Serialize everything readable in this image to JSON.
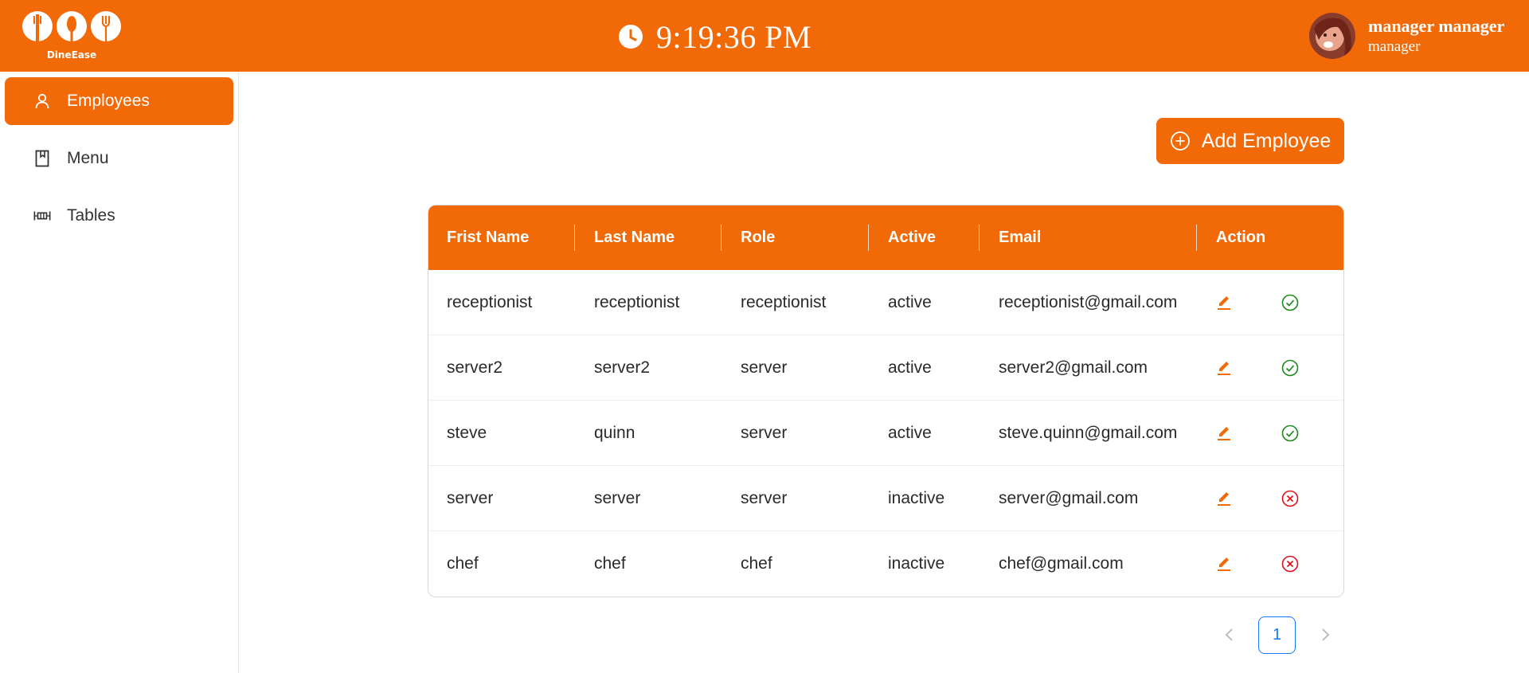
{
  "app": {
    "name": "DineEase"
  },
  "header": {
    "time": "9:19:36 PM",
    "user_name": "manager manager",
    "user_role": "manager"
  },
  "sidebar": {
    "items": [
      {
        "label": "Employees",
        "icon": "user-icon",
        "active": true
      },
      {
        "label": "Menu",
        "icon": "book-icon",
        "active": false
      },
      {
        "label": "Tables",
        "icon": "table-icon",
        "active": false
      }
    ]
  },
  "toolbar": {
    "add_label": "Add Employee"
  },
  "table": {
    "columns": [
      "Frist Name",
      "Last Name",
      "Role",
      "Active",
      "Email",
      "Action"
    ],
    "rows": [
      {
        "first": "receptionist",
        "last": "receptionist",
        "role": "receptionist",
        "active": "active",
        "email": "receptionist@gmail.com"
      },
      {
        "first": "server2",
        "last": "server2",
        "role": "server",
        "active": "active",
        "email": "server2@gmail.com"
      },
      {
        "first": "steve",
        "last": "quinn",
        "role": "server",
        "active": "active",
        "email": "steve.quinn@gmail.com"
      },
      {
        "first": "server",
        "last": "server",
        "role": "server",
        "active": "inactive",
        "email": "server@gmail.com"
      },
      {
        "first": "chef",
        "last": "chef",
        "role": "chef",
        "active": "inactive",
        "email": "chef@gmail.com"
      }
    ]
  },
  "pagination": {
    "current_page": "1"
  },
  "colors": {
    "brand": "#f26a08",
    "success": "#1a8a1a",
    "danger": "#e0101a",
    "link": "#1677ff"
  }
}
